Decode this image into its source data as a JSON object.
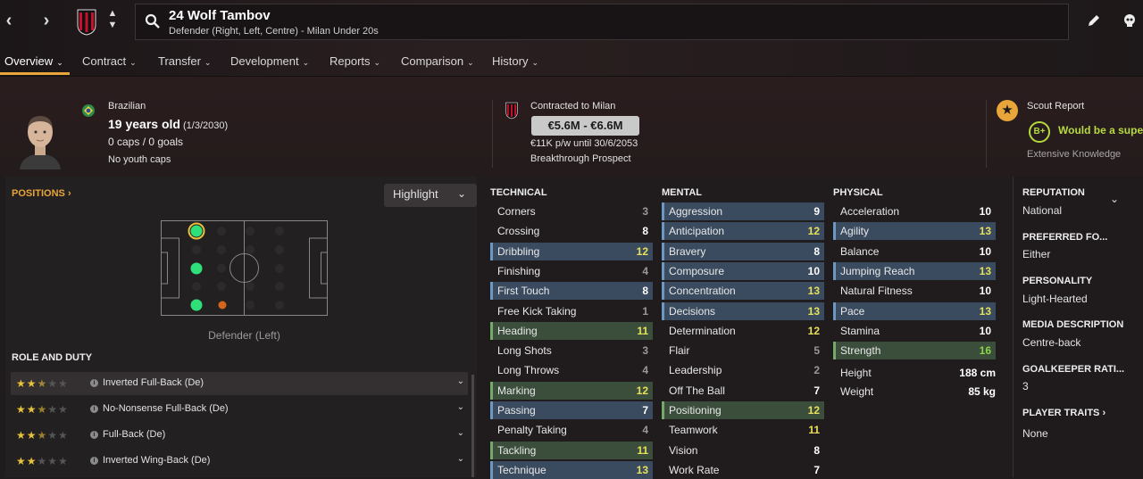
{
  "player": {
    "name": "24 Wolf Tambov",
    "subtitle": "Defender (Right, Left, Centre) - Milan Under 20s"
  },
  "tabs": [
    {
      "label": "Overview"
    },
    {
      "label": "Contract"
    },
    {
      "label": "Transfer"
    },
    {
      "label": "Development"
    },
    {
      "label": "Reports"
    },
    {
      "label": "Comparison"
    },
    {
      "label": "History"
    }
  ],
  "header": {
    "nationality": "Brazilian",
    "age": "19 years old",
    "dob": "(1/3/2030)",
    "caps": "0 caps / 0 goals",
    "youth_caps": "No youth caps",
    "contracted": "Contracted to Milan",
    "value": "€5.6M - €6.6M",
    "wage": "€11K p/w until 30/6/2053",
    "status": "Breakthrough Prospect",
    "scout_title": "Scout Report",
    "scout_grade": "B+",
    "scout_text": "Would be a super",
    "scout_knowledge": "Extensive Knowledge"
  },
  "positions": {
    "title": "POSITIONS",
    "highlight_label": "Highlight",
    "position_label": "Defender (Left)"
  },
  "roles": {
    "title": "ROLE AND DUTY",
    "items": [
      {
        "name": "Inverted Full-Back (De)",
        "stars": 2.5
      },
      {
        "name": "No-Nonsense Full-Back (De)",
        "stars": 2.5
      },
      {
        "name": "Full-Back (De)",
        "stars": 2.5
      },
      {
        "name": "Inverted Wing-Back (De)",
        "stars": 2
      }
    ]
  },
  "attributes": {
    "technical_title": "TECHNICAL",
    "mental_title": "MENTAL",
    "physical_title": "PHYSICAL",
    "technical": [
      {
        "name": "Corners",
        "value": "3"
      },
      {
        "name": "Crossing",
        "value": "8"
      },
      {
        "name": "Dribbling",
        "value": "12"
      },
      {
        "name": "Finishing",
        "value": "4"
      },
      {
        "name": "First Touch",
        "value": "8"
      },
      {
        "name": "Free Kick Taking",
        "value": "1"
      },
      {
        "name": "Heading",
        "value": "11"
      },
      {
        "name": "Long Shots",
        "value": "3"
      },
      {
        "name": "Long Throws",
        "value": "4"
      },
      {
        "name": "Marking",
        "value": "12"
      },
      {
        "name": "Passing",
        "value": "7"
      },
      {
        "name": "Penalty Taking",
        "value": "4"
      },
      {
        "name": "Tackling",
        "value": "11"
      },
      {
        "name": "Technique",
        "value": "13"
      }
    ],
    "mental": [
      {
        "name": "Aggression",
        "value": "9"
      },
      {
        "name": "Anticipation",
        "value": "12"
      },
      {
        "name": "Bravery",
        "value": "8"
      },
      {
        "name": "Composure",
        "value": "10"
      },
      {
        "name": "Concentration",
        "value": "13"
      },
      {
        "name": "Decisions",
        "value": "13"
      },
      {
        "name": "Determination",
        "value": "12"
      },
      {
        "name": "Flair",
        "value": "5"
      },
      {
        "name": "Leadership",
        "value": "2"
      },
      {
        "name": "Off The Ball",
        "value": "7"
      },
      {
        "name": "Positioning",
        "value": "12"
      },
      {
        "name": "Teamwork",
        "value": "11"
      },
      {
        "name": "Vision",
        "value": "8"
      },
      {
        "name": "Work Rate",
        "value": "7"
      }
    ],
    "physical": [
      {
        "name": "Acceleration",
        "value": "10"
      },
      {
        "name": "Agility",
        "value": "13"
      },
      {
        "name": "Balance",
        "value": "10"
      },
      {
        "name": "Jumping Reach",
        "value": "13"
      },
      {
        "name": "Natural Fitness",
        "value": "10"
      },
      {
        "name": "Pace",
        "value": "13"
      },
      {
        "name": "Stamina",
        "value": "10"
      },
      {
        "name": "Strength",
        "value": "16"
      }
    ],
    "height_label": "Height",
    "height": "188 cm",
    "weight_label": "Weight",
    "weight": "85 kg"
  },
  "side": {
    "reputation_title": "REPUTATION",
    "reputation": "National",
    "foot_title": "PREFERRED FO...",
    "foot": "Either",
    "personality_title": "PERSONALITY",
    "personality": "Light-Hearted",
    "media_title": "MEDIA DESCRIPTION",
    "media": "Centre-back",
    "gk_title": "GOALKEEPER RATI...",
    "gk": "3",
    "traits_title": "PLAYER TRAITS",
    "traits": "None"
  },
  "colors": {
    "accent": "#e8a53a",
    "highlight_blue": "#3a4b5f",
    "highlight_green": "#3b4d3b",
    "value_yellow": "#e8e05a",
    "value_green": "#8bd448",
    "scout_green": "#b6d93d"
  },
  "icons": {
    "back": "chevron-left-icon",
    "forward": "chevron-right-icon",
    "club": "milan-badge-icon",
    "search": "search-icon",
    "edit": "pencil-icon",
    "skull": "skull-icon"
  }
}
